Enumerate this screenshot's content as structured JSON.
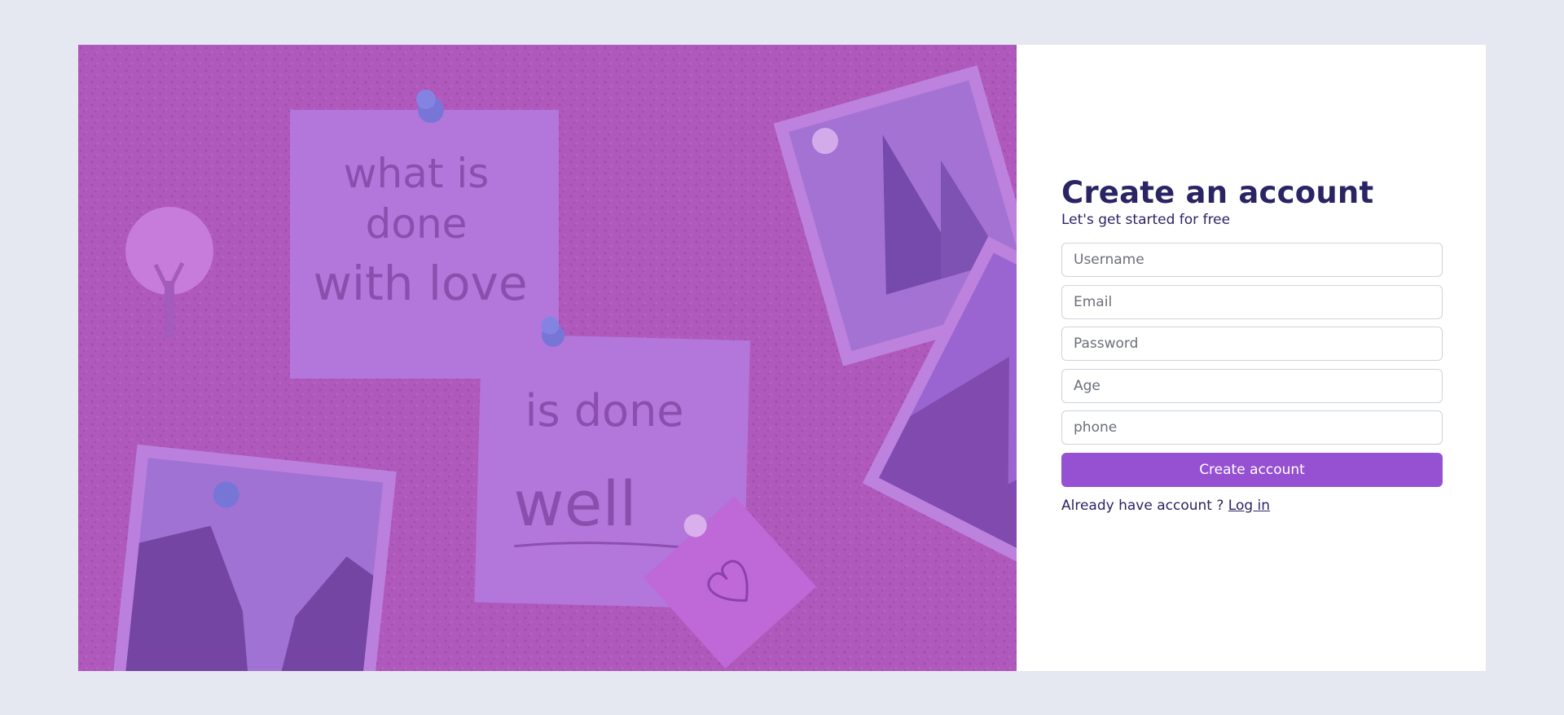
{
  "hero": {
    "note1_lines": [
      "what is",
      "done",
      "with love"
    ],
    "note2_lines": [
      "is done",
      "well"
    ]
  },
  "form": {
    "title": "Create an account",
    "subtitle": "Let's get started for free",
    "fields": {
      "username": "Username",
      "email": "Email",
      "password": "Password",
      "age": "Age",
      "phone": "phone"
    },
    "submit_label": "Create account",
    "login_prompt": "Already have account ?",
    "login_link": "Log in"
  },
  "colors": {
    "page_background": "#e5e7f1",
    "title": "#2b2464",
    "button": "#9650d2",
    "hero_overlay": "#9b4fd0"
  }
}
